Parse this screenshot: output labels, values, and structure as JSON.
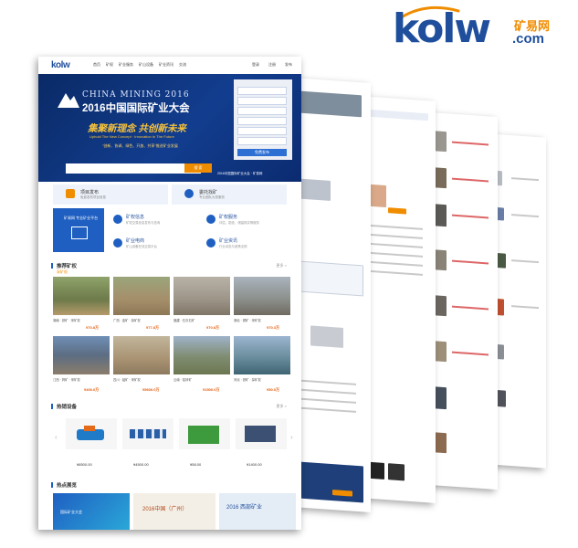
{
  "logo": {
    "word": "kolw",
    "cn": "矿易网",
    "com": ".com"
  },
  "nav": {
    "logo": "kolw",
    "items": [
      "首页",
      "矿权",
      "矿业服务",
      "矿山设备",
      "矿业资讯",
      "交流"
    ],
    "right": [
      "登录",
      "注册",
      "发布"
    ]
  },
  "hero": {
    "en": "CHINA MINING 2016",
    "cn": "2016中国国际矿业大会",
    "slogan": "集聚新理念 共创新未来",
    "sub": "Uphold The New Concept · Innovation In The Future",
    "lines": "\"创新、协调、绿色、开放、共享\"推进矿业发展",
    "search_btn": "搜 索",
    "form_btn": "免费发布",
    "marquee": "2016中国国际矿业大会 · 矿易网"
  },
  "row2": {
    "a": {
      "title": "项目发布",
      "sub": "免费发布项目信息"
    },
    "b": {
      "title": "委托找矿",
      "sub": "专业团队为您服务"
    }
  },
  "services": {
    "blue": "矿易网 专业矿业平台",
    "cells": [
      {
        "title": "矿权信息",
        "desc": "矿权交易信息发布与查询"
      },
      {
        "title": "矿权服务",
        "desc": "评估、勘查、储量核实等服务"
      },
      {
        "title": "矿业电商",
        "desc": "矿山设备在线交易平台"
      },
      {
        "title": "矿业资讯",
        "desc": "行业动态与政策法规"
      }
    ]
  },
  "mines": {
    "title": "推荐矿权",
    "tab": "采矿权",
    "more": "更多 >",
    "items": [
      {
        "cap": "湖南 · 铁矿 · 采矿权",
        "price": "¥70.8万"
      },
      {
        "cap": "广西 · 金矿 · 探矿权",
        "price": "¥77.8万"
      },
      {
        "cap": "福建 · 石灰石矿",
        "price": "¥70.8万"
      },
      {
        "cap": "湖北 · 铜矿 · 采矿权",
        "price": "¥70.3万"
      },
      {
        "cap": "江西 · 钨矿 · 采矿权",
        "price": "¥400.0万"
      },
      {
        "cap": "四川 · 锰矿 · 采矿权",
        "price": "¥5600.0万"
      },
      {
        "cap": "云南 · 铅锌矿",
        "price": "¥1500.0万"
      },
      {
        "cap": "河北 · 铁矿 · 探矿权",
        "price": "¥50.0万"
      }
    ]
  },
  "hot": {
    "title": "热销设备",
    "more": "更多 >",
    "items": [
      {
        "price": "¥8500.00"
      },
      {
        "price": "¥4500.00"
      },
      {
        "price": "¥58.00"
      },
      {
        "price": "¥1400.00"
      }
    ]
  },
  "meeting": {
    "title": "热点展览",
    "items": [
      "国际矿业大会",
      "2016中国（广州）",
      "2016 西部矿业"
    ]
  },
  "colors": {
    "brand_blue": "#1f4f9c",
    "accent_orange": "#f08c00",
    "hero_bg": "#0d3175"
  }
}
